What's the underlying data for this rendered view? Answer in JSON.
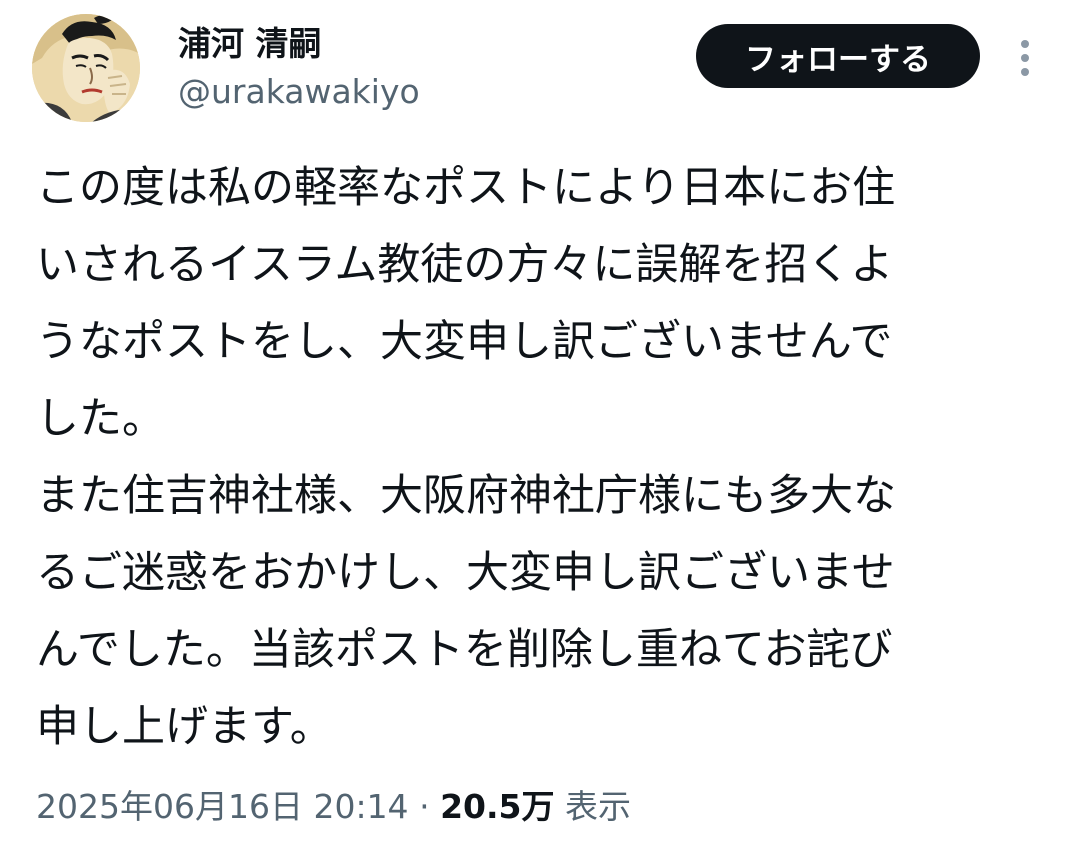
{
  "user": {
    "display_name": "浦河 清嗣",
    "handle": "@urakawakiyo",
    "avatar": "ukiyo-e-portrait-avatar"
  },
  "actions": {
    "follow_label": "フォローする",
    "more_icon": "vertical-ellipsis-icon"
  },
  "post": {
    "lines": [
      "この度は私の軽率なポストにより日本にお住",
      "いされるイスラム教徒の方々に誤解を招くよ",
      "うなポストをし、大変申し訳ございませんで",
      "した。",
      "また住吉神社様、大阪府神社庁様にも多大な",
      "るご迷惑をおかけし、大変申し訳ございませ",
      "んでした。当該ポストを削除し重ねてお詫び",
      "申し上げます。"
    ]
  },
  "meta": {
    "timestamp": "2025年06月16日 20:14",
    "separator": "·",
    "views_count": "20.5万",
    "views_label": "表示"
  },
  "colors": {
    "text_primary": "#0f1419",
    "text_secondary": "#536471",
    "button_bg": "#0f1419",
    "button_text": "#ffffff",
    "more_icon": "#8b98a5"
  }
}
